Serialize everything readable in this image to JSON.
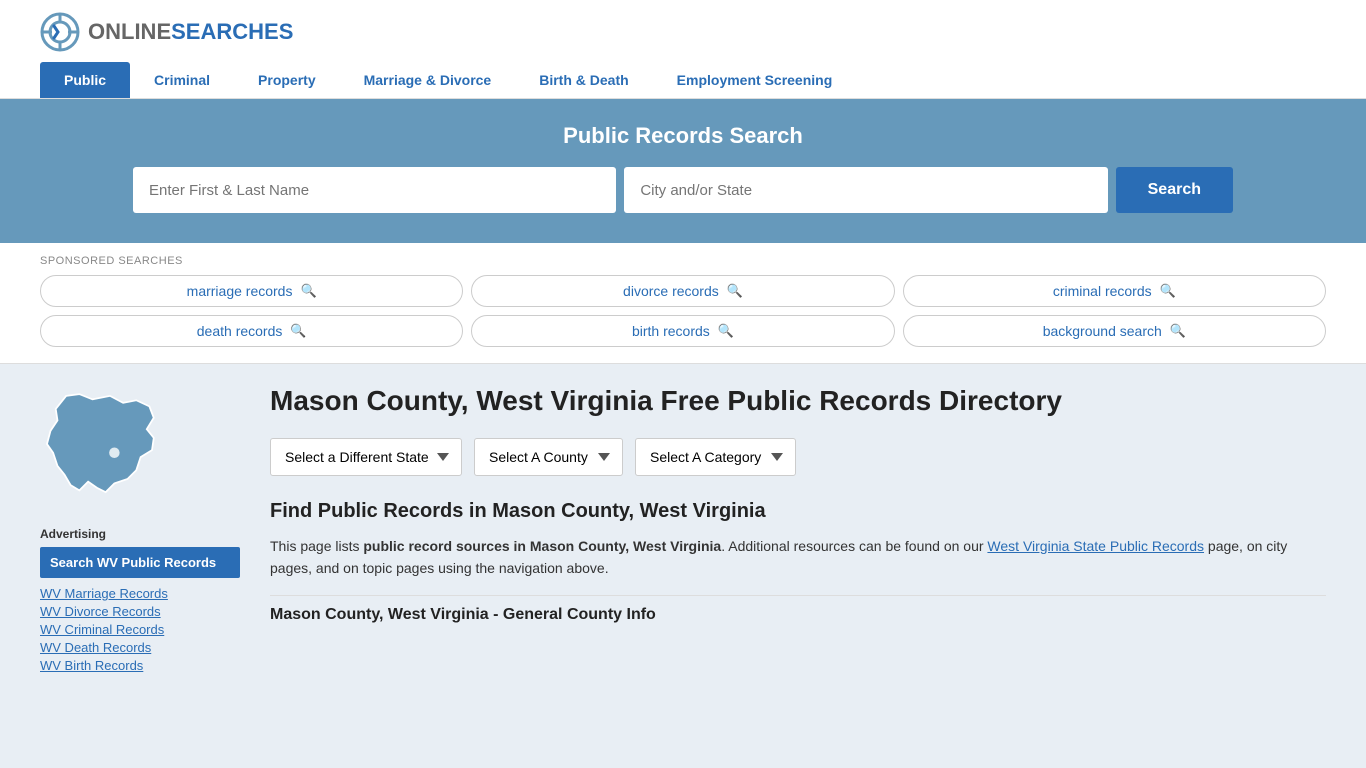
{
  "logo": {
    "online": "ONLINE",
    "searches": "SEARCHES"
  },
  "nav": {
    "items": [
      {
        "label": "Public",
        "active": true
      },
      {
        "label": "Criminal",
        "active": false
      },
      {
        "label": "Property",
        "active": false
      },
      {
        "label": "Marriage & Divorce",
        "active": false
      },
      {
        "label": "Birth & Death",
        "active": false
      },
      {
        "label": "Employment Screening",
        "active": false
      }
    ]
  },
  "hero": {
    "title": "Public Records Search",
    "name_placeholder": "Enter First & Last Name",
    "location_placeholder": "City and/or State",
    "search_button": "Search"
  },
  "sponsored": {
    "label": "SPONSORED SEARCHES",
    "items": [
      "marriage records",
      "divorce records",
      "criminal records",
      "death records",
      "birth records",
      "background search"
    ]
  },
  "sidebar": {
    "ad_label": "Advertising",
    "ad_button": "Search WV Public Records",
    "links": [
      "WV Marriage Records",
      "WV Divorce Records",
      "WV Criminal Records",
      "WV Death Records",
      "WV Birth Records"
    ]
  },
  "content": {
    "title": "Mason County, West Virginia Free Public Records Directory",
    "dropdowns": {
      "state": "Select a Different State",
      "county": "Select A County",
      "category": "Select A Category"
    },
    "find_title": "Find Public Records in Mason County, West Virginia",
    "find_text_part1": "This page lists ",
    "find_text_bold": "public record sources in Mason County, West Virginia",
    "find_text_part2": ". Additional resources can be found on our ",
    "find_link": "West Virginia State Public Records",
    "find_text_part3": " page, on city pages, and on topic pages using the navigation above.",
    "section_subtitle": "Mason County, West Virginia - General County Info"
  }
}
